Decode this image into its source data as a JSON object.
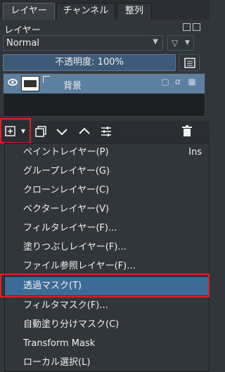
{
  "tabs": [
    {
      "label": "レイヤー",
      "active": true
    },
    {
      "label": "チャンネル",
      "active": false
    },
    {
      "label": "整列",
      "active": false
    }
  ],
  "docker": {
    "title": "レイヤー"
  },
  "blend": {
    "mode": "Normal"
  },
  "opacity": {
    "label": "不透明度: 100%"
  },
  "layer": {
    "name": "背景",
    "alpha_symbol": "α"
  },
  "menu": {
    "items": [
      {
        "label": "ペイントレイヤー(P)",
        "shortcut": "Ins"
      },
      {
        "label": "グループレイヤー(G)",
        "shortcut": ""
      },
      {
        "label": "クローンレイヤー(C)",
        "shortcut": ""
      },
      {
        "label": "ベクターレイヤー(V)",
        "shortcut": ""
      },
      {
        "label": "フィルタレイヤー(F)...",
        "shortcut": ""
      },
      {
        "label": "塗りつぶしレイヤー(F)...",
        "shortcut": ""
      },
      {
        "label": "ファイル参照レイヤー(F)...",
        "shortcut": ""
      },
      {
        "label": "透過マスク(T)",
        "shortcut": "",
        "selected": true
      },
      {
        "label": "フィルタマスク(F)...",
        "shortcut": ""
      },
      {
        "label": "自動塗り分けマスク(C)",
        "shortcut": ""
      },
      {
        "label": "Transform Mask",
        "shortcut": ""
      },
      {
        "label": "ローカル選択(L)",
        "shortcut": ""
      }
    ]
  },
  "colors": {
    "selection": "#3d6b97",
    "layer_selected": "#5d7fa0",
    "highlight_box": "#e02020"
  }
}
